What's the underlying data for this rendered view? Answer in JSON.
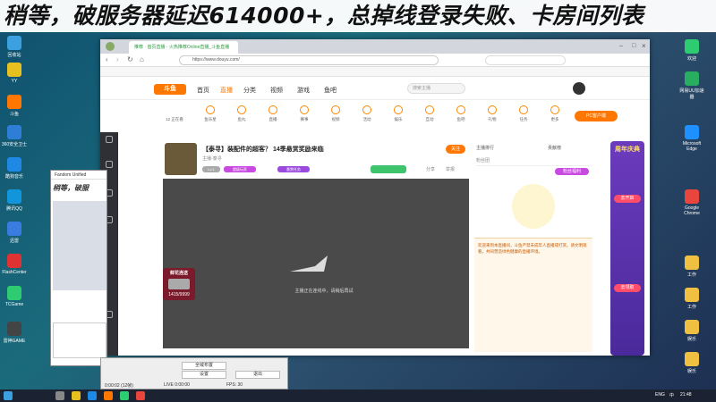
{
  "banner": {
    "text": "稍等，破服务器延迟614000+，总掉线登录失败、卡房间列表"
  },
  "desktop": {
    "left_icons": [
      {
        "label": "回收站",
        "color": "#3aa0e0"
      },
      {
        "label": "YY",
        "color": "#e8c020"
      },
      {
        "label": "斗鱼",
        "color": "#ff7700"
      },
      {
        "label": "360安全卫士",
        "color": "#2e7dd7"
      },
      {
        "label": "酷狗音乐",
        "color": "#1e88e5"
      },
      {
        "label": "腾讯QQ",
        "color": "#1296db"
      },
      {
        "label": "迅雷",
        "color": "#3a7be0"
      },
      {
        "label": "FlashCenter",
        "color": "#d33"
      },
      {
        "label": "TCGame",
        "color": "#2ecc71"
      },
      {
        "label": "雷神GAME",
        "color": "#444"
      }
    ],
    "right_icons": [
      {
        "label": "欢迎",
        "color": "#2ecc71"
      },
      {
        "label": "网易UU加速器",
        "color": "#27ae60"
      },
      {
        "label": "Microsoft Edge",
        "color": "#1e90ff"
      },
      {
        "label": "Google Chrome",
        "color": "#e8453c"
      },
      {
        "label": "工作",
        "color": "#f0c040"
      },
      {
        "label": "工作",
        "color": "#f0c040"
      },
      {
        "label": "娱乐",
        "color": "#f0c040"
      },
      {
        "label": "娱乐",
        "color": "#f0c040"
      }
    ]
  },
  "browser": {
    "tab_title": "推荐 · 首页直播 · 火热推荐Online直播_斗鱼直播",
    "url": "https://www.douyu.com/",
    "site": {
      "logo": "斗鱼",
      "nav": [
        "首页",
        "直播",
        "分类",
        "视频",
        "游戏",
        "鱼吧"
      ],
      "search_placeholder": "搜索主播",
      "categories": [
        "12 正在看",
        "鱼乐星",
        "鱼丸",
        "直播",
        "赛事",
        "视频",
        "活动",
        "娱乐",
        "互动",
        "鱼吧",
        "礼物",
        "任务",
        "更多"
      ],
      "pc_client": "PC客户端"
    },
    "room": {
      "title": "【泰寻】装配件的超客？ 14季悬赏奖励来临",
      "streamer": "主播·泰寻",
      "follow": "关注",
      "level": "Lv.1",
      "tags": [
        "超级玩家",
        "悬赏任务"
      ],
      "share": "分享",
      "report": "举报"
    },
    "player": {
      "status": "主播正在连线中，请稍后再试"
    },
    "right_panel": {
      "tabs": [
        "主播排行",
        "贡献榜",
        "粉丝团"
      ],
      "rank": "粉丝福利",
      "notice": "欢迎来到本直播间，斗鱼严禁未成年人直播或打赏。请文明观看，共同营造绿色健康的直播环境。"
    },
    "ad": {
      "title": "周年庆典",
      "button1": "去开启",
      "button2": "去领取"
    }
  },
  "popup": {
    "title": "Fandom Unified",
    "items": [
      "稍等，破服"
    ]
  },
  "bottom_window": {
    "labels": [
      "全域布置",
      "退出",
      "设置"
    ],
    "stats": [
      "0:00:02 (12帧)",
      "LIVE 0:00:00",
      "FPS: 30"
    ]
  },
  "gift": {
    "label": "鲜花连送",
    "count": "1415/9999"
  },
  "taskbar": {
    "time": "21:48",
    "lang": "ENG",
    "zh": "中"
  }
}
